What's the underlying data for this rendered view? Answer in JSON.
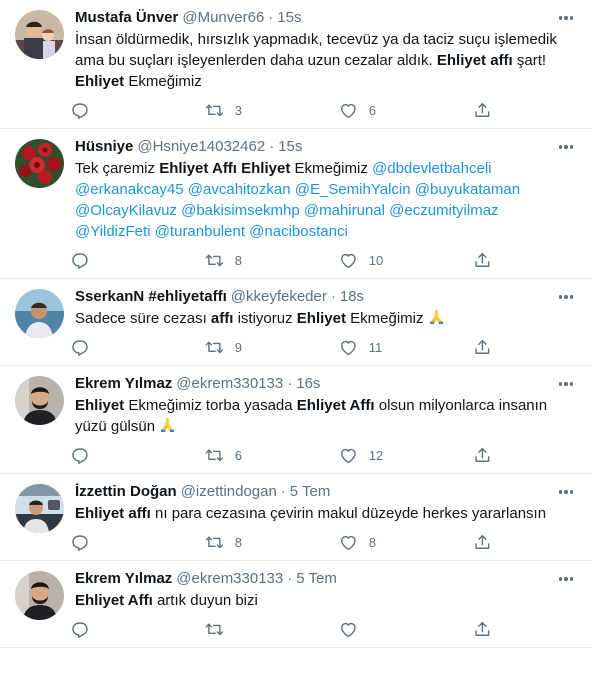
{
  "tweets": [
    {
      "name": "Mustafa Ünver",
      "handle": "@Munver66",
      "time": "15s",
      "avatar": "photo-man-with-child",
      "text": [
        {
          "t": "İnsan öldürmedik, hırsızlık yapmadık, tecevüz ya da taciz suçu işlemedik ama bu suçları işleyenlerden daha uzun cezalar aldık. "
        },
        {
          "t": "Ehliyet affı",
          "b": true
        },
        {
          "t": " şart! "
        },
        {
          "t": "Ehliyet",
          "b": true
        },
        {
          "t": " Ekmeğimiz"
        }
      ],
      "replies": "",
      "retweets": "3",
      "likes": "6"
    },
    {
      "name": "Hüsniye",
      "handle": "@Hsniye14032462",
      "time": "15s",
      "avatar": "photo-red-roses",
      "text": [
        {
          "t": "Tek çaremiz "
        },
        {
          "t": "Ehliyet Affı Ehliyet",
          "b": true
        },
        {
          "t": " Ekmeğimiz "
        },
        {
          "t": "@dbdevletbahceli",
          "m": true
        },
        {
          "t": " "
        },
        {
          "t": "@erkanakcay45",
          "m": true
        },
        {
          "t": " "
        },
        {
          "t": "@avcahitozkan",
          "m": true
        },
        {
          "t": " "
        },
        {
          "t": "@E_SemihYalcin",
          "m": true
        },
        {
          "t": " "
        },
        {
          "t": "@buyukataman",
          "m": true
        },
        {
          "t": " "
        },
        {
          "t": "@OlcayKilavuz",
          "m": true
        },
        {
          "t": " "
        },
        {
          "t": "@bakisimsekmhp",
          "m": true
        },
        {
          "t": " "
        },
        {
          "t": "@mahirunal",
          "m": true
        },
        {
          "t": " "
        },
        {
          "t": "@eczumityilmaz",
          "m": true
        },
        {
          "t": " "
        },
        {
          "t": "@YildizFeti",
          "m": true
        },
        {
          "t": " "
        },
        {
          "t": "@turanbulent",
          "m": true
        },
        {
          "t": " "
        },
        {
          "t": "@nacibostanci",
          "m": true
        }
      ],
      "replies": "",
      "retweets": "8",
      "likes": "10"
    },
    {
      "name": "SserkanN #ehliyetaffı",
      "handle": "@kkeyfekeder",
      "time": "18s",
      "avatar": "photo-man-at-sea",
      "text": [
        {
          "t": "Sadece süre cezası "
        },
        {
          "t": "affı",
          "b": true
        },
        {
          "t": " istiyoruz "
        },
        {
          "t": "Ehliyet",
          "b": true
        },
        {
          "t": " Ekmeğimiz "
        },
        {
          "emoji": "folded-hands"
        }
      ],
      "replies": "",
      "retweets": "9",
      "likes": "11"
    },
    {
      "name": "Ekrem Yılmaz",
      "handle": "@ekrem330133",
      "time": "16s",
      "avatar": "photo-young-man",
      "text": [
        {
          "t": "Ehliyet",
          "b": true
        },
        {
          "t": " Ekmeğimiz torba yasada "
        },
        {
          "t": "Ehliyet Affı",
          "b": true
        },
        {
          "t": " olsun milyonlarca insanın yüzü gülsün "
        },
        {
          "emoji": "folded-hands"
        }
      ],
      "replies": "",
      "retweets": "6",
      "likes": "12"
    },
    {
      "name": "İzzettin Doğan",
      "handle": "@izettindogan",
      "time": "5 Tem",
      "avatar": "photo-man-in-car",
      "text": [
        {
          "t": "Ehliyet affı",
          "b": true
        },
        {
          "t": " nı para cezasına çevirin makul düzeyde herkes yararlansın"
        }
      ],
      "replies": "",
      "retweets": "8",
      "likes": "8"
    },
    {
      "name": "Ekrem Yılmaz",
      "handle": "@ekrem330133",
      "time": "5 Tem",
      "avatar": "photo-young-man",
      "text": [
        {
          "t": "Ehliyet Affı",
          "b": true
        },
        {
          "t": " artık duyun bizi"
        }
      ],
      "replies": "",
      "retweets": "",
      "likes": ""
    }
  ],
  "icons": {
    "reply": "reply-icon",
    "retweet": "retweet-icon",
    "like": "like-icon",
    "share": "share-icon",
    "more": "more-icon"
  },
  "colors": {
    "text": "#0f1419",
    "secondary": "#5b7083",
    "mention": "#1b95e0",
    "divider": "#e6ecf0"
  }
}
